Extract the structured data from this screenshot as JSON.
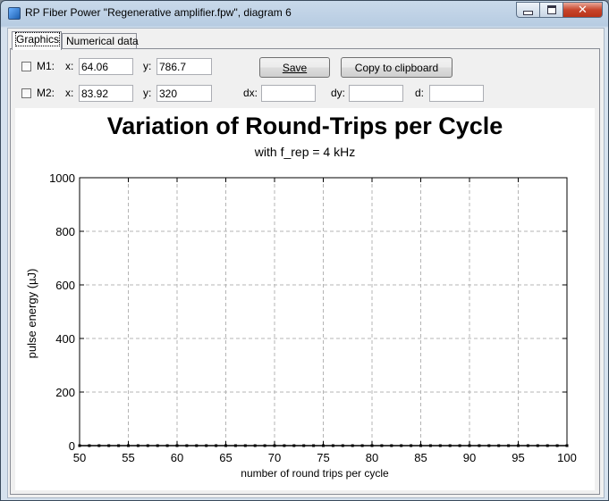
{
  "window": {
    "title": "RP Fiber Power \"Regenerative amplifier.fpw\", diagram 6"
  },
  "tabs": [
    {
      "label": "Graphics",
      "active": true
    },
    {
      "label": "Numerical data",
      "active": false
    }
  ],
  "markers": {
    "m1": {
      "label": "M1:",
      "x_label": "x:",
      "x": "64.06",
      "y_label": "y:",
      "y": "786.7",
      "checked": false
    },
    "m2": {
      "label": "M2:",
      "x_label": "x:",
      "x": "83.92",
      "y_label": "y:",
      "y": "320",
      "checked": false
    }
  },
  "deltas": {
    "dx_label": "dx:",
    "dx": "",
    "dy_label": "dy:",
    "dy": "",
    "d_label": "d:",
    "d": ""
  },
  "buttons": {
    "save": "Save",
    "copy": "Copy to clipboard"
  },
  "chart_data": {
    "type": "line",
    "title": "Variation of Round-Trips per Cycle",
    "subtitle": "with f_rep = 4 kHz",
    "xlabel": "number of round trips per cycle",
    "ylabel": "pulse energy (µJ)",
    "xlim": [
      50,
      100
    ],
    "ylim": [
      0,
      1000
    ],
    "x_ticks": [
      50,
      55,
      60,
      65,
      70,
      75,
      80,
      85,
      90,
      95,
      100
    ],
    "y_ticks": [
      0,
      200,
      400,
      600,
      800,
      1000
    ],
    "grid": true,
    "series": [
      {
        "color": "#000000",
        "x": [
          50,
          51,
          52,
          53,
          54,
          55,
          56,
          57,
          58,
          59,
          60,
          61,
          62,
          63,
          64,
          65,
          66,
          67,
          68,
          69,
          70,
          71,
          72,
          73,
          74,
          75,
          76,
          77,
          78,
          79,
          80,
          81,
          82,
          83,
          84,
          85,
          86,
          87,
          88,
          89,
          90,
          91,
          92,
          93,
          94,
          95,
          96,
          97,
          98,
          99,
          100
        ],
        "y": [
          0,
          0,
          0,
          0,
          0,
          0,
          0,
          0,
          0,
          0,
          0,
          0,
          0,
          0,
          0,
          0,
          0,
          0,
          0,
          0,
          0,
          0,
          0,
          0,
          0,
          0,
          0,
          0,
          0,
          0,
          0,
          0,
          0,
          0,
          0,
          0,
          0,
          0,
          0,
          0,
          0,
          0,
          0,
          0,
          0,
          0,
          0,
          0,
          0,
          0,
          0
        ]
      }
    ]
  }
}
